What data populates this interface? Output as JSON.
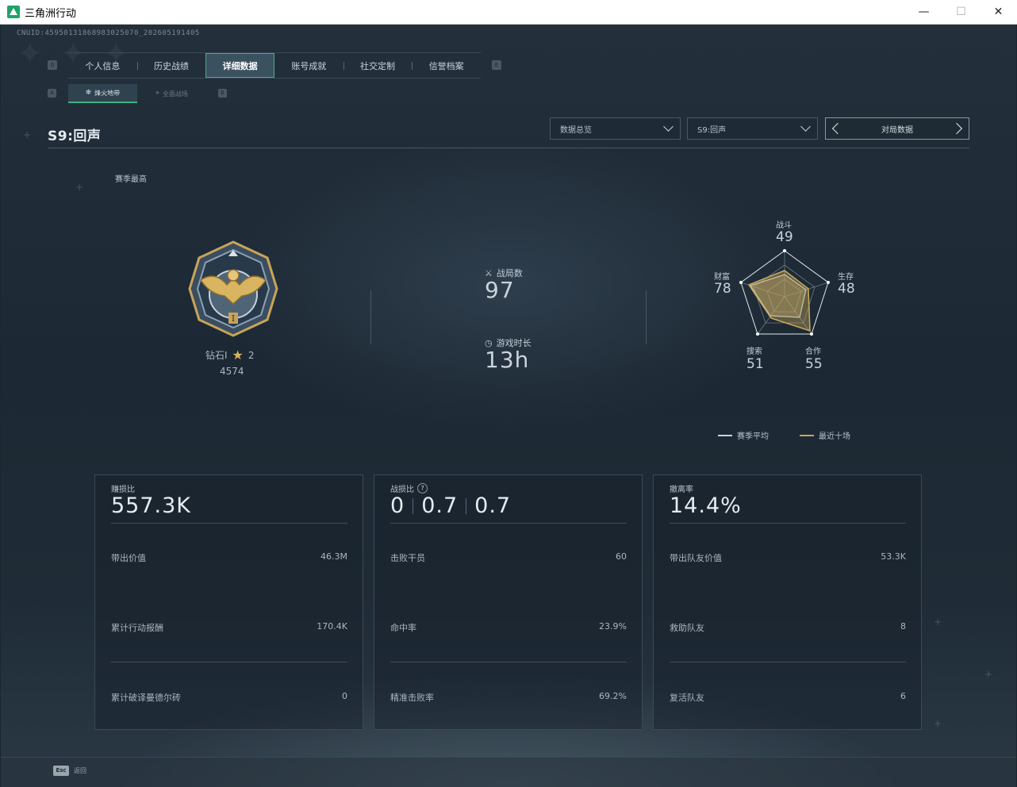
{
  "window": {
    "title": "三角洲行动",
    "min": "—",
    "max": "☐",
    "close": "✕"
  },
  "cnuid": "CNUID:45950131868983025070_202605191405",
  "tab_keys": {
    "left": "Q",
    "right": "E"
  },
  "tabs": [
    {
      "label": "个人信息",
      "active": false
    },
    {
      "label": "历史战绩",
      "active": false
    },
    {
      "label": "详细数据",
      "active": true
    },
    {
      "label": "账号成就",
      "active": false
    },
    {
      "label": "社交定制",
      "active": false
    },
    {
      "label": "信誉档案",
      "active": false
    }
  ],
  "subtab_keys": {
    "left": "A",
    "right": "D"
  },
  "subtabs": [
    {
      "label": "烽火地带",
      "active": true
    },
    {
      "label": "全面战场",
      "active": false
    }
  ],
  "season_title": "S9:回声",
  "filters": {
    "view": "数据总览",
    "season": "S9:回声",
    "pager": "对局数据"
  },
  "season_best": "赛季最高",
  "rank": {
    "name": "钻石I",
    "stars": "2",
    "points": "4574"
  },
  "matches": {
    "label": "战局数",
    "value": "97"
  },
  "playtime": {
    "label": "游戏时长",
    "value": "13h"
  },
  "radar": {
    "axes": [
      {
        "label": "战斗",
        "value": "49"
      },
      {
        "label": "生存",
        "value": "48"
      },
      {
        "label": "合作",
        "value": "55"
      },
      {
        "label": "搜索",
        "value": "51"
      },
      {
        "label": "财富",
        "value": "78"
      }
    ],
    "legend": {
      "season_avg": "赛季平均",
      "recent_ten": "最近十场"
    },
    "colors": {
      "season_avg": "#c9d3dc",
      "recent_ten": "#c9a85a"
    }
  },
  "panels": {
    "profit": {
      "title": "赚损比",
      "big": "557.3K",
      "rows": [
        {
          "label": "带出价值",
          "value": "46.3M"
        },
        {
          "label": "累计行动报酬",
          "value": "170.4K"
        },
        {
          "label": "累计破译曼德尔砖",
          "value": "0"
        }
      ]
    },
    "kd": {
      "title": "战损比",
      "help": "?",
      "big": [
        "0",
        "0.7",
        "0.7"
      ],
      "rows": [
        {
          "label": "击败干员",
          "value": "60"
        },
        {
          "label": "命中率",
          "value": "23.9%"
        },
        {
          "label": "精准击败率",
          "value": "69.2%"
        }
      ]
    },
    "extract": {
      "title": "撤离率",
      "big": "14.4%",
      "rows": [
        {
          "label": "带出队友价值",
          "value": "53.3K"
        },
        {
          "label": "救助队友",
          "value": "8"
        },
        {
          "label": "复活队友",
          "value": "6"
        }
      ]
    }
  },
  "footer": {
    "esc_key": "Esc",
    "esc_label": "返回"
  }
}
